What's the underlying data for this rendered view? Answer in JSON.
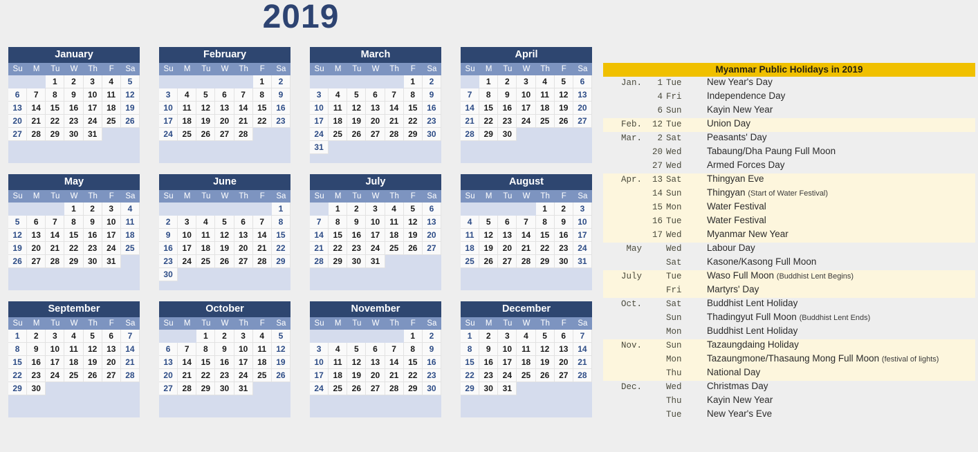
{
  "year_title": "2019",
  "colors": {
    "page_background": "#eeeeee",
    "month_header": "#2e4670",
    "dow_row": "#7d94c0",
    "day_cell": "#fafafa",
    "empty_cell": "#d5dced",
    "weekend_text": "#2d4c86",
    "weekday_text": "#1a1a1a",
    "title_text": "#2d4371",
    "holiday_header": "#f0c000",
    "holiday_tint_row": "#fdf6dd"
  },
  "dow_labels": [
    "Su",
    "M",
    "Tu",
    "W",
    "Th",
    "F",
    "Sa"
  ],
  "months": [
    {
      "name": "January",
      "weeks": [
        [
          null,
          null,
          1,
          2,
          3,
          4,
          5
        ],
        [
          6,
          7,
          8,
          9,
          10,
          11,
          12
        ],
        [
          13,
          14,
          15,
          16,
          17,
          18,
          19
        ],
        [
          20,
          21,
          22,
          23,
          24,
          25,
          26
        ],
        [
          27,
          28,
          29,
          30,
          31,
          null,
          null
        ]
      ]
    },
    {
      "name": "February",
      "weeks": [
        [
          null,
          null,
          null,
          null,
          null,
          1,
          2
        ],
        [
          3,
          4,
          5,
          6,
          7,
          8,
          9
        ],
        [
          10,
          11,
          12,
          13,
          14,
          15,
          16
        ],
        [
          17,
          18,
          19,
          20,
          21,
          22,
          23
        ],
        [
          24,
          25,
          26,
          27,
          28,
          null,
          null
        ]
      ]
    },
    {
      "name": "March",
      "weeks": [
        [
          null,
          null,
          null,
          null,
          null,
          1,
          2
        ],
        [
          3,
          4,
          5,
          6,
          7,
          8,
          9
        ],
        [
          10,
          11,
          12,
          13,
          14,
          15,
          16
        ],
        [
          17,
          18,
          19,
          20,
          21,
          22,
          23
        ],
        [
          24,
          25,
          26,
          27,
          28,
          29,
          30
        ],
        [
          31,
          null,
          null,
          null,
          null,
          null,
          null
        ]
      ]
    },
    {
      "name": "April",
      "weeks": [
        [
          null,
          1,
          2,
          3,
          4,
          5,
          6
        ],
        [
          7,
          8,
          9,
          10,
          11,
          12,
          13
        ],
        [
          14,
          15,
          16,
          17,
          18,
          19,
          20
        ],
        [
          21,
          22,
          23,
          24,
          25,
          26,
          27
        ],
        [
          28,
          29,
          30,
          null,
          null,
          null,
          null
        ]
      ]
    },
    {
      "name": "May",
      "weeks": [
        [
          null,
          null,
          null,
          1,
          2,
          3,
          4
        ],
        [
          5,
          6,
          7,
          8,
          9,
          10,
          11
        ],
        [
          12,
          13,
          14,
          15,
          16,
          17,
          18
        ],
        [
          19,
          20,
          21,
          22,
          23,
          24,
          25
        ],
        [
          26,
          27,
          28,
          29,
          30,
          31,
          null
        ]
      ]
    },
    {
      "name": "June",
      "weeks": [
        [
          null,
          null,
          null,
          null,
          null,
          null,
          1
        ],
        [
          2,
          3,
          4,
          5,
          6,
          7,
          8
        ],
        [
          9,
          10,
          11,
          12,
          13,
          14,
          15
        ],
        [
          16,
          17,
          18,
          19,
          20,
          21,
          22
        ],
        [
          23,
          24,
          25,
          26,
          27,
          28,
          29
        ],
        [
          30,
          null,
          null,
          null,
          null,
          null,
          null
        ]
      ]
    },
    {
      "name": "July",
      "weeks": [
        [
          null,
          1,
          2,
          3,
          4,
          5,
          6
        ],
        [
          7,
          8,
          9,
          10,
          11,
          12,
          13
        ],
        [
          14,
          15,
          16,
          17,
          18,
          19,
          20
        ],
        [
          21,
          22,
          23,
          24,
          25,
          26,
          27
        ],
        [
          28,
          29,
          30,
          31,
          null,
          null,
          null
        ]
      ]
    },
    {
      "name": "August",
      "weeks": [
        [
          null,
          null,
          null,
          null,
          1,
          2,
          3
        ],
        [
          4,
          5,
          6,
          7,
          8,
          9,
          10
        ],
        [
          11,
          12,
          13,
          14,
          15,
          16,
          17
        ],
        [
          18,
          19,
          20,
          21,
          22,
          23,
          24
        ],
        [
          25,
          26,
          27,
          28,
          29,
          30,
          31
        ]
      ]
    },
    {
      "name": "September",
      "weeks": [
        [
          1,
          2,
          3,
          4,
          5,
          6,
          7
        ],
        [
          8,
          9,
          10,
          11,
          12,
          13,
          14
        ],
        [
          15,
          16,
          17,
          18,
          19,
          20,
          21
        ],
        [
          22,
          23,
          24,
          25,
          26,
          27,
          28
        ],
        [
          29,
          30,
          null,
          null,
          null,
          null,
          null
        ]
      ]
    },
    {
      "name": "October",
      "weeks": [
        [
          null,
          null,
          1,
          2,
          3,
          4,
          5
        ],
        [
          6,
          7,
          8,
          9,
          10,
          11,
          12
        ],
        [
          13,
          14,
          15,
          16,
          17,
          18,
          19
        ],
        [
          20,
          21,
          22,
          23,
          24,
          25,
          26
        ],
        [
          27,
          28,
          29,
          30,
          31,
          null,
          null
        ]
      ]
    },
    {
      "name": "November",
      "weeks": [
        [
          null,
          null,
          null,
          null,
          null,
          1,
          2
        ],
        [
          3,
          4,
          5,
          6,
          7,
          8,
          9
        ],
        [
          10,
          11,
          12,
          13,
          14,
          15,
          16
        ],
        [
          17,
          18,
          19,
          20,
          21,
          22,
          23
        ],
        [
          24,
          25,
          26,
          27,
          28,
          29,
          30
        ]
      ]
    },
    {
      "name": "December",
      "weeks": [
        [
          1,
          2,
          3,
          4,
          5,
          6,
          7
        ],
        [
          8,
          9,
          10,
          11,
          12,
          13,
          14
        ],
        [
          15,
          16,
          17,
          18,
          19,
          20,
          21
        ],
        [
          22,
          23,
          24,
          25,
          26,
          27,
          28
        ],
        [
          29,
          30,
          31,
          null,
          null,
          null,
          null
        ]
      ]
    }
  ],
  "holidays": {
    "header": "Myanmar Public Holidays in 2019",
    "rows": [
      {
        "month": "Jan.",
        "day": "1",
        "dow": "Tue",
        "name": "New Year's Day",
        "note": "",
        "tint": false
      },
      {
        "month": "",
        "day": "4",
        "dow": "Fri",
        "name": "Independence Day",
        "note": "",
        "tint": false
      },
      {
        "month": "",
        "day": "6",
        "dow": "Sun",
        "name": "Kayin New Year",
        "note": "",
        "tint": false
      },
      {
        "month": "Feb.",
        "day": "12",
        "dow": "Tue",
        "name": "Union Day",
        "note": "",
        "tint": true
      },
      {
        "month": "Mar.",
        "day": "2",
        "dow": "Sat",
        "name": "Peasants' Day",
        "note": "",
        "tint": false
      },
      {
        "month": "",
        "day": "20",
        "dow": "Wed",
        "name": "Tabaung/Dha Paung Full Moon",
        "note": "",
        "tint": false
      },
      {
        "month": "",
        "day": "27",
        "dow": "Wed",
        "name": "Armed Forces Day",
        "note": "",
        "tint": false
      },
      {
        "month": "Apr.",
        "day": "13",
        "dow": "Sat",
        "name": "Thingyan Eve",
        "note": "",
        "tint": true
      },
      {
        "month": "",
        "day": "14",
        "dow": "Sun",
        "name": "Thingyan",
        "note": "(Start of Water Festival)",
        "tint": true
      },
      {
        "month": "",
        "day": "15",
        "dow": "Mon",
        "name": "Water Festival",
        "note": "",
        "tint": true
      },
      {
        "month": "",
        "day": "16",
        "dow": "Tue",
        "name": "Water Festival",
        "note": "",
        "tint": true
      },
      {
        "month": "",
        "day": "17",
        "dow": "Wed",
        "name": "Myanmar New Year",
        "note": "",
        "tint": true
      },
      {
        "month": "May",
        "day": "",
        "dow": "Wed",
        "name": "Labour Day",
        "note": "",
        "tint": false
      },
      {
        "month": "",
        "day": "",
        "dow": "Sat",
        "name": "Kasone/Kasong Full Moon",
        "note": "",
        "tint": false
      },
      {
        "month": "July",
        "day": "",
        "dow": "Tue",
        "name": "Waso Full Moon",
        "note": "(Buddhist Lent Begins)",
        "tint": true
      },
      {
        "month": "",
        "day": "",
        "dow": "Fri",
        "name": "Martyrs' Day",
        "note": "",
        "tint": true
      },
      {
        "month": "Oct.",
        "day": "",
        "dow": "Sat",
        "name": "Buddhist Lent Holiday",
        "note": "",
        "tint": false
      },
      {
        "month": "",
        "day": "",
        "dow": "Sun",
        "name": "Thadingyut Full Moon",
        "note": "(Buddhist Lent Ends)",
        "tint": false
      },
      {
        "month": "",
        "day": "",
        "dow": "Mon",
        "name": "Buddhist Lent Holiday",
        "note": "",
        "tint": false
      },
      {
        "month": "Nov.",
        "day": "",
        "dow": "Sun",
        "name": "Tazaungdaing Holiday",
        "note": "",
        "tint": true
      },
      {
        "month": "",
        "day": "",
        "dow": "Mon",
        "name": "Tazaungmone/Thasaung Mong Full Moon",
        "note": "(festival of lights)",
        "tint": true
      },
      {
        "month": "",
        "day": "",
        "dow": "Thu",
        "name": "National Day",
        "note": "",
        "tint": true
      },
      {
        "month": "Dec.",
        "day": "",
        "dow": "Wed",
        "name": "Christmas Day",
        "note": "",
        "tint": false
      },
      {
        "month": "",
        "day": "",
        "dow": "Thu",
        "name": "Kayin New Year",
        "note": "",
        "tint": false
      },
      {
        "month": "",
        "day": "",
        "dow": "Tue",
        "name": "New Year's Eve",
        "note": "",
        "tint": false
      }
    ]
  }
}
